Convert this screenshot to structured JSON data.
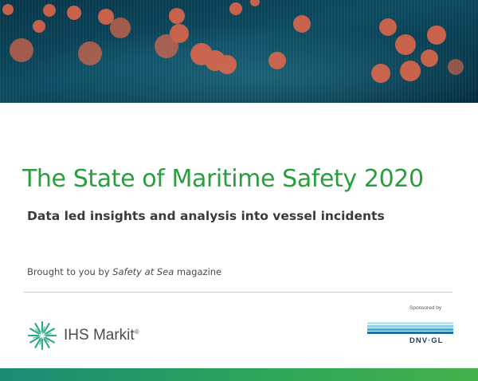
{
  "header": {
    "image": "maritime data bokeh banner"
  },
  "title": "The State of Maritime Safety 2020",
  "subtitle": "Data led insights and analysis into vessel incidents",
  "credit": {
    "prefix": "Brought to you by ",
    "publication": "Safety at Sea",
    "suffix": " magazine"
  },
  "brand": {
    "name": "IHS Markit",
    "mark": "®",
    "icon": "ihs-markit-swirl-icon"
  },
  "sponsor": {
    "label": "Sponsored by",
    "name": "DNV·GL"
  },
  "colors": {
    "title": "#2a9e3e",
    "banner": "#0b3a4e",
    "bokeh": "#e8684a",
    "footer": "#2ea55a"
  }
}
